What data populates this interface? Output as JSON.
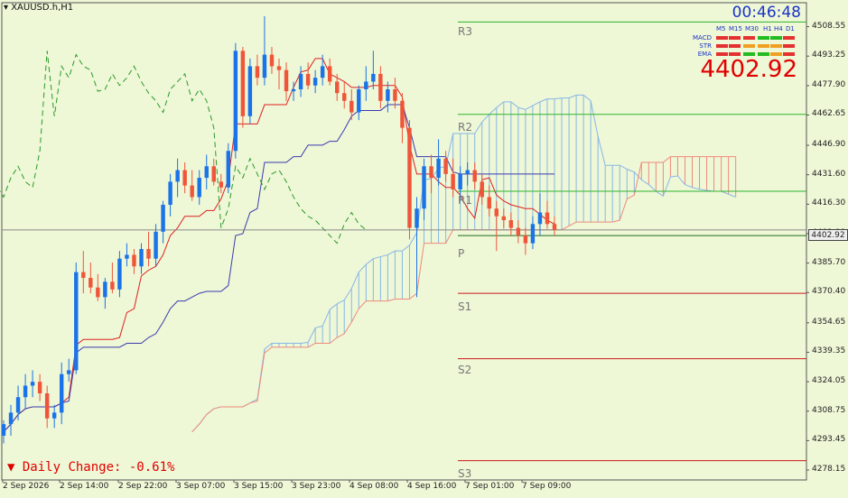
{
  "symbol": "XAUUSD.h,H1",
  "timer": "00:46:48",
  "big_price": "4402.92",
  "daily_change": "Daily Change: -0.61%",
  "current_price_tag": "4402.92",
  "colors": {
    "background": "#eef7d6",
    "bull": "#1a73e8",
    "bear": "#f0553a",
    "resistance": "#2db52d",
    "support": "#cc1a1a",
    "cloud_bull": "#87b7e8",
    "cloud_bear": "#f08a7a",
    "kumo_fill": "#c9c8f2",
    "tenkan": "#e02020",
    "kijun": "#3b3bb0",
    "chikou": "#2a9a2a",
    "gold_level": "#d99a1a"
  },
  "signal_panel": {
    "timeframes": [
      "M5",
      "M15",
      "M30",
      "H1",
      "H4",
      "D1"
    ],
    "indicators": [
      {
        "name": "MACD",
        "signals": [
          "red",
          "red",
          "red",
          "green",
          "green",
          "red"
        ]
      },
      {
        "name": "STR",
        "signals": [
          "red",
          "red",
          "orange",
          "orange",
          "orange",
          "red"
        ]
      },
      {
        "name": "EMA",
        "signals": [
          "red",
          "red",
          "green",
          "green",
          "orange",
          "red"
        ]
      }
    ]
  },
  "chart_data": {
    "type": "candlestick",
    "ylim": [
      4273,
      4521
    ],
    "x_ticks": [
      "2 Sep 2026",
      "2 Sep 14:00",
      "2 Sep 22:00",
      "3 Sep 07:00",
      "3 Sep 15:00",
      "3 Sep 23:00",
      "4 Sep 08:00",
      "4 Sep 16:00",
      "7 Sep 01:00",
      "7 Sep 09:00"
    ],
    "y_ticks": [
      4508.55,
      4493.25,
      4477.9,
      4462.65,
      4446.9,
      4431.6,
      4416.3,
      4401.0,
      4385.7,
      4370.4,
      4354.65,
      4339.35,
      4324.05,
      4308.75,
      4293.45,
      4278.15
    ],
    "current_price": 4402.92,
    "pivot_levels": [
      {
        "name": "R3",
        "value": 4511
      },
      {
        "name": "R2",
        "value": 4463
      },
      {
        "name": "R1",
        "value": 4423
      },
      {
        "name": "P",
        "value": 4400
      },
      {
        "name": "S1",
        "value": 4370
      },
      {
        "name": "S2",
        "value": 4336
      },
      {
        "name": "S3",
        "value": 4283
      }
    ],
    "candles": [
      {
        "o": 4296,
        "h": 4304,
        "l": 4292,
        "c": 4302
      },
      {
        "o": 4302,
        "h": 4312,
        "l": 4296,
        "c": 4308
      },
      {
        "o": 4308,
        "h": 4322,
        "l": 4304,
        "c": 4316
      },
      {
        "o": 4316,
        "h": 4328,
        "l": 4310,
        "c": 4322
      },
      {
        "o": 4322,
        "h": 4330,
        "l": 4316,
        "c": 4324
      },
      {
        "o": 4324,
        "h": 4328,
        "l": 4314,
        "c": 4318
      },
      {
        "o": 4318,
        "h": 4322,
        "l": 4300,
        "c": 4305
      },
      {
        "o": 4305,
        "h": 4312,
        "l": 4300,
        "c": 4308
      },
      {
        "o": 4308,
        "h": 4334,
        "l": 4302,
        "c": 4328
      },
      {
        "o": 4328,
        "h": 4336,
        "l": 4324,
        "c": 4330
      },
      {
        "o": 4330,
        "h": 4386,
        "l": 4328,
        "c": 4381
      },
      {
        "o": 4381,
        "h": 4392,
        "l": 4370,
        "c": 4378
      },
      {
        "o": 4378,
        "h": 4386,
        "l": 4370,
        "c": 4373
      },
      {
        "o": 4373,
        "h": 4380,
        "l": 4366,
        "c": 4368
      },
      {
        "o": 4368,
        "h": 4378,
        "l": 4362,
        "c": 4376
      },
      {
        "o": 4376,
        "h": 4386,
        "l": 4370,
        "c": 4372
      },
      {
        "o": 4372,
        "h": 4392,
        "l": 4368,
        "c": 4388
      },
      {
        "o": 4388,
        "h": 4396,
        "l": 4384,
        "c": 4390
      },
      {
        "o": 4390,
        "h": 4393,
        "l": 4380,
        "c": 4384
      },
      {
        "o": 4384,
        "h": 4396,
        "l": 4380,
        "c": 4393
      },
      {
        "o": 4393,
        "h": 4402,
        "l": 4384,
        "c": 4388
      },
      {
        "o": 4388,
        "h": 4406,
        "l": 4384,
        "c": 4402
      },
      {
        "o": 4402,
        "h": 4418,
        "l": 4396,
        "c": 4416
      },
      {
        "o": 4416,
        "h": 4432,
        "l": 4410,
        "c": 4428
      },
      {
        "o": 4428,
        "h": 4440,
        "l": 4420,
        "c": 4434
      },
      {
        "o": 4434,
        "h": 4438,
        "l": 4422,
        "c": 4426
      },
      {
        "o": 4426,
        "h": 4434,
        "l": 4418,
        "c": 4420
      },
      {
        "o": 4420,
        "h": 4434,
        "l": 4416,
        "c": 4430
      },
      {
        "o": 4430,
        "h": 4442,
        "l": 4424,
        "c": 4436
      },
      {
        "o": 4436,
        "h": 4440,
        "l": 4426,
        "c": 4428
      },
      {
        "o": 4428,
        "h": 4432,
        "l": 4422,
        "c": 4425
      },
      {
        "o": 4425,
        "h": 4448,
        "l": 4422,
        "c": 4444
      },
      {
        "o": 4444,
        "h": 4500,
        "l": 4440,
        "c": 4496
      },
      {
        "o": 4496,
        "h": 4498,
        "l": 4456,
        "c": 4462
      },
      {
        "o": 4462,
        "h": 4492,
        "l": 4458,
        "c": 4488
      },
      {
        "o": 4488,
        "h": 4494,
        "l": 4478,
        "c": 4482
      },
      {
        "o": 4482,
        "h": 4514,
        "l": 4478,
        "c": 4494
      },
      {
        "o": 4494,
        "h": 4498,
        "l": 4484,
        "c": 4488
      },
      {
        "o": 4488,
        "h": 4492,
        "l": 4476,
        "c": 4486
      },
      {
        "o": 4486,
        "h": 4490,
        "l": 4470,
        "c": 4475
      },
      {
        "o": 4475,
        "h": 4480,
        "l": 4470,
        "c": 4476
      },
      {
        "o": 4476,
        "h": 4488,
        "l": 4472,
        "c": 4484
      },
      {
        "o": 4484,
        "h": 4490,
        "l": 4476,
        "c": 4478
      },
      {
        "o": 4478,
        "h": 4486,
        "l": 4474,
        "c": 4482
      },
      {
        "o": 4482,
        "h": 4494,
        "l": 4478,
        "c": 4488
      },
      {
        "o": 4488,
        "h": 4492,
        "l": 4478,
        "c": 4480
      },
      {
        "o": 4480,
        "h": 4484,
        "l": 4470,
        "c": 4474
      },
      {
        "o": 4474,
        "h": 4480,
        "l": 4466,
        "c": 4470
      },
      {
        "o": 4470,
        "h": 4476,
        "l": 4460,
        "c": 4464
      },
      {
        "o": 4464,
        "h": 4478,
        "l": 4460,
        "c": 4476
      },
      {
        "o": 4476,
        "h": 4488,
        "l": 4470,
        "c": 4480
      },
      {
        "o": 4480,
        "h": 4496,
        "l": 4476,
        "c": 4484
      },
      {
        "o": 4484,
        "h": 4488,
        "l": 4466,
        "c": 4470
      },
      {
        "o": 4470,
        "h": 4480,
        "l": 4464,
        "c": 4476
      },
      {
        "o": 4476,
        "h": 4482,
        "l": 4466,
        "c": 4470
      },
      {
        "o": 4470,
        "h": 4474,
        "l": 4448,
        "c": 4456
      },
      {
        "o": 4456,
        "h": 4460,
        "l": 4398,
        "c": 4404
      },
      {
        "o": 4404,
        "h": 4420,
        "l": 4368,
        "c": 4414
      },
      {
        "o": 4414,
        "h": 4440,
        "l": 4408,
        "c": 4436
      },
      {
        "o": 4436,
        "h": 4442,
        "l": 4422,
        "c": 4430
      },
      {
        "o": 4430,
        "h": 4450,
        "l": 4426,
        "c": 4440
      },
      {
        "o": 4440,
        "h": 4444,
        "l": 4428,
        "c": 4432
      },
      {
        "o": 4432,
        "h": 4440,
        "l": 4420,
        "c": 4424
      },
      {
        "o": 4424,
        "h": 4436,
        "l": 4418,
        "c": 4432
      },
      {
        "o": 4432,
        "h": 4438,
        "l": 4426,
        "c": 4434
      },
      {
        "o": 4434,
        "h": 4438,
        "l": 4424,
        "c": 4428
      },
      {
        "o": 4428,
        "h": 4432,
        "l": 4416,
        "c": 4420
      },
      {
        "o": 4420,
        "h": 4426,
        "l": 4410,
        "c": 4414
      },
      {
        "o": 4414,
        "h": 4418,
        "l": 4392,
        "c": 4410
      },
      {
        "o": 4410,
        "h": 4414,
        "l": 4404,
        "c": 4408
      },
      {
        "o": 4408,
        "h": 4412,
        "l": 4400,
        "c": 4404
      },
      {
        "o": 4404,
        "h": 4408,
        "l": 4396,
        "c": 4400
      },
      {
        "o": 4400,
        "h": 4404,
        "l": 4390,
        "c": 4396
      },
      {
        "o": 4396,
        "h": 4410,
        "l": 4393,
        "c": 4406
      },
      {
        "o": 4406,
        "h": 4422,
        "l": 4400,
        "c": 4412
      },
      {
        "o": 4412,
        "h": 4418,
        "l": 4404,
        "c": 4406
      },
      {
        "o": 4406,
        "h": 4410,
        "l": 4400,
        "c": 4403
      }
    ]
  }
}
